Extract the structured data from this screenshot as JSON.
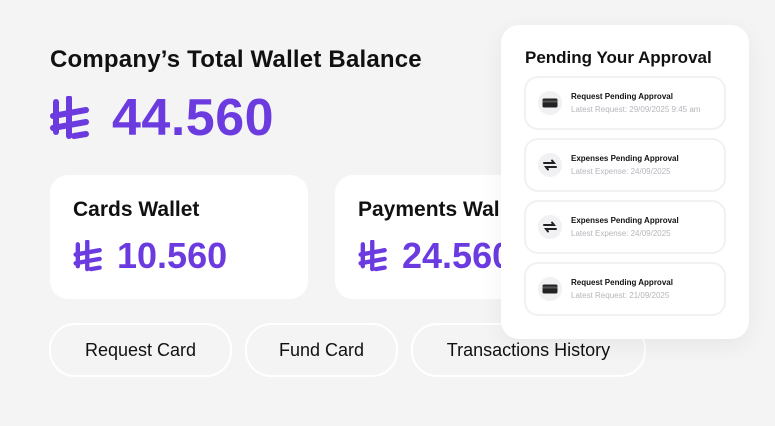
{
  "total": {
    "title": "Company’s Total Wallet Balance",
    "amount": "44.560",
    "currency_icon": "riyal-currency-icon"
  },
  "wallets": [
    {
      "label": "Cards Wallet",
      "amount": "10.560"
    },
    {
      "label": "Payments Wallet",
      "amount": "24.560"
    }
  ],
  "actions": {
    "request_card": "Request Card",
    "fund_card": "Fund Card",
    "transactions_history": "Transactions History"
  },
  "approvals": {
    "title": "Pending Your Approval",
    "items": [
      {
        "icon": "card-icon",
        "title": "Request Pending Approval",
        "subtitle": "Latest Request: 29/09/2025 9:45 am"
      },
      {
        "icon": "transfer-icon",
        "title": "Expenses Pending Approval",
        "subtitle": "Latest Expense: 24/09/2025"
      },
      {
        "icon": "transfer-icon",
        "title": "Expenses Pending Approval",
        "subtitle": "Latest Expense: 24/09/2025"
      },
      {
        "icon": "card-icon",
        "title": "Request Pending Approval",
        "subtitle": "Latest Request: 21/09/2025"
      }
    ]
  },
  "colors": {
    "accent": "#6b3be0",
    "background": "#f4f4f5",
    "card": "#ffffff",
    "muted_text": "#b6b6bc"
  }
}
